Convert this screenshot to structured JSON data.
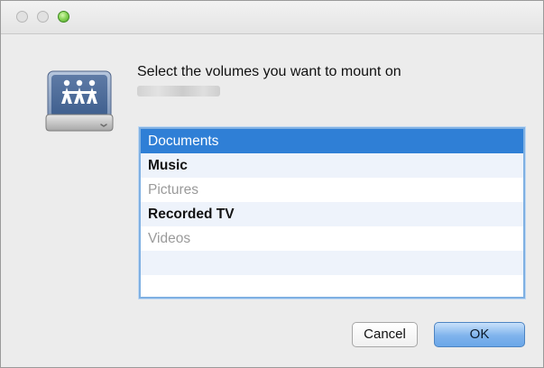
{
  "window": {
    "controls": [
      "close",
      "minimize",
      "zoom"
    ]
  },
  "dialog": {
    "icon": "network-volume-icon",
    "prompt": "Select the volumes you want to mount on"
  },
  "volumes": [
    {
      "label": "Documents",
      "state": "selected"
    },
    {
      "label": "Music",
      "state": "enabled"
    },
    {
      "label": "Pictures",
      "state": "disabled"
    },
    {
      "label": "Recorded TV",
      "state": "enabled"
    },
    {
      "label": "Videos",
      "state": "disabled"
    }
  ],
  "buttons": {
    "cancel": "Cancel",
    "ok": "OK"
  },
  "colors": {
    "selection": "#2f7fd6",
    "default_button": "#7fb3ec",
    "list_stripe": "#eef3fb"
  }
}
